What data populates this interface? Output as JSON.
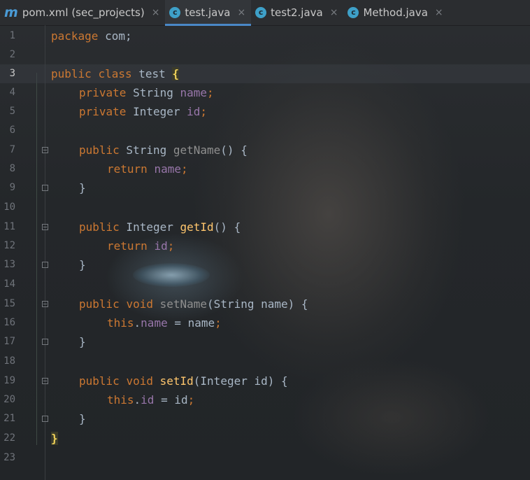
{
  "tabs": [
    {
      "icon": "maven-m-icon",
      "label": "pom.xml (sec_projects)",
      "active": false
    },
    {
      "icon": "java-class-icon",
      "label": "test.java",
      "active": true
    },
    {
      "icon": "java-class-icon",
      "label": "test2.java",
      "active": false
    },
    {
      "icon": "java-class-icon",
      "label": "Method.java",
      "active": false
    }
  ],
  "tab_close_glyph": "×",
  "current_line": 3,
  "line_numbers": [
    "1",
    "2",
    "3",
    "4",
    "5",
    "6",
    "7",
    "8",
    "9",
    "10",
    "11",
    "12",
    "13",
    "14",
    "15",
    "16",
    "17",
    "18",
    "19",
    "20",
    "21",
    "22",
    "23"
  ],
  "code": {
    "l1": {
      "kw": "package",
      "rest": " com;"
    },
    "l3": {
      "kw1": "public",
      "kw2": "class",
      "name": " test ",
      "brace": "{"
    },
    "l4": {
      "kw": "private",
      "type": " String ",
      "field": "name",
      "end": ";"
    },
    "l5": {
      "kw": "private",
      "type": " Integer ",
      "field": "id",
      "end": ";"
    },
    "l7": {
      "kw": "public",
      "type": " String ",
      "method": "getName",
      "rest": "() {"
    },
    "l8": {
      "kw": "return",
      "field": "name",
      "end": ";"
    },
    "l9": {
      "text": "}"
    },
    "l11": {
      "kw": "public",
      "type": " Integer ",
      "method": "getId",
      "rest": "() {"
    },
    "l12": {
      "kw": "return",
      "field": "id",
      "end": ";"
    },
    "l13": {
      "text": "}"
    },
    "l15": {
      "kw1": "public",
      "kw2": "void",
      "method": "setName",
      "rest": "(String name) {"
    },
    "l16": {
      "kw": "this",
      "dot": ".",
      "field": "name",
      "rest": " = name",
      "end": ";"
    },
    "l17": {
      "text": "}"
    },
    "l19": {
      "kw1": "public",
      "kw2": "void",
      "method": "setId",
      "rest": "(Integer id) {"
    },
    "l20": {
      "kw": "this",
      "dot": ".",
      "field": "id",
      "rest": " = id",
      "end": ";"
    },
    "l21": {
      "text": "}"
    },
    "l22": {
      "brace": "}"
    }
  },
  "colors": {
    "keyword": "#cc7832",
    "field": "#9876aa",
    "method": "#ffc66d",
    "text": "#a9b7c6",
    "tab_active_underline": "#4a88c7"
  }
}
